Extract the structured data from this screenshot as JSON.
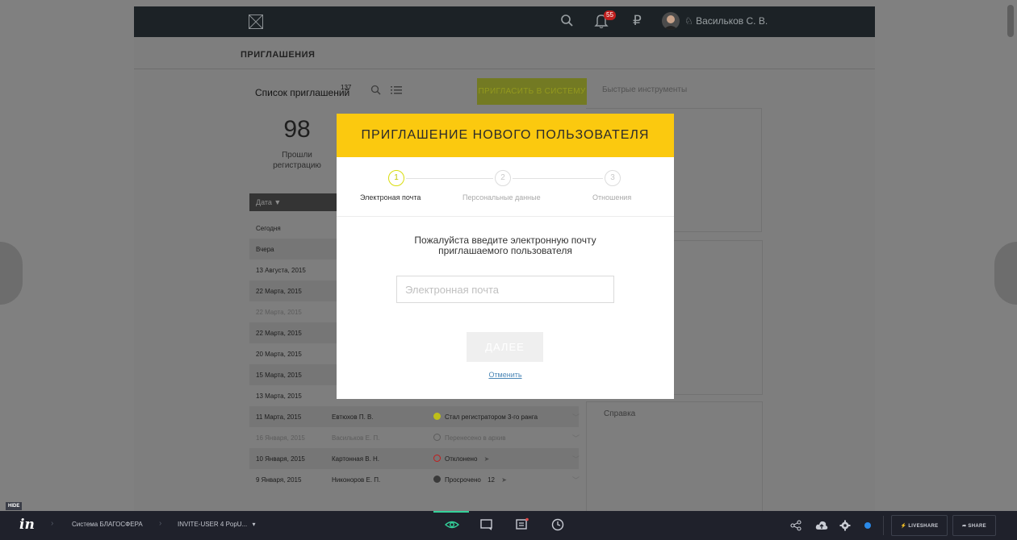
{
  "app": {
    "user_name": "Васильков С. В.",
    "notifications_count": "55",
    "currency_symbol": "₽",
    "page_title": "ПРИГЛАШЕНИЯ"
  },
  "list": {
    "title": "Список приглашений",
    "count": "137",
    "invite_button": "ПРИГЛАСИТЬ В СИСТЕМУ",
    "quick_tools": "Быстрые инструменты",
    "stat_value": "98",
    "stat_label": "Прошли регистрацию",
    "date_header": "Дата ▼",
    "help_label": "Справка",
    "rows": [
      {
        "date": "Сегодня",
        "name": "",
        "status": ""
      },
      {
        "date": "Вчера",
        "name": "",
        "status": ""
      },
      {
        "date": "13 Августа, 2015",
        "name": "",
        "status": ""
      },
      {
        "date": "22 Марта, 2015",
        "name": "",
        "status": ""
      },
      {
        "date": "22 Марта, 2015",
        "name": "",
        "status": ""
      },
      {
        "date": "22 Марта, 2015",
        "name": "",
        "status": ""
      },
      {
        "date": "20 Марта, 2015",
        "name": "",
        "status": ""
      },
      {
        "date": "15 Марта, 2015",
        "name": "",
        "status": ""
      },
      {
        "date": "13 Марта, 2015",
        "name": "",
        "status": ""
      },
      {
        "date": "11 Марта, 2015",
        "name": "Евтюхов П. В.",
        "status": "Стал регистратором 3-го ранга"
      },
      {
        "date": "16 Января, 2015",
        "name": "Васильков Е. П.",
        "status": "Перенесено в архив"
      },
      {
        "date": "10 Января, 2015",
        "name": "Картонная В. Н.",
        "status": "Отклонено"
      },
      {
        "date": "9 Января, 2015",
        "name": "Никоноров Е. П.",
        "status": "Просрочено",
        "extra": "12"
      }
    ]
  },
  "modal": {
    "title": "ПРИГЛАШЕНИЕ НОВОГО ПОЛЬЗОВАТЕЛЯ",
    "steps": [
      {
        "num": "1",
        "label": "Электроная почта"
      },
      {
        "num": "2",
        "label": "Персональные данные"
      },
      {
        "num": "3",
        "label": "Отношения"
      }
    ],
    "prompt": "Пожалуйста введите электронную почту приглашаемого пользователя",
    "email_placeholder": "Электронная почта",
    "next_button": "ДАЛЕЕ",
    "cancel_link": "Отменить"
  },
  "invision": {
    "hide_label": "HIDE",
    "project": "Система БЛАГОСФЕРА",
    "screen": "INVITE-USER 4 PopU...",
    "liveshare": "LIVESHARE",
    "share": "SHARE"
  },
  "colors": {
    "accent_yellow": "#fbc90f",
    "invite_green": "#93991e",
    "topbar": "#1c2226",
    "invision_bar": "#1f212b"
  }
}
